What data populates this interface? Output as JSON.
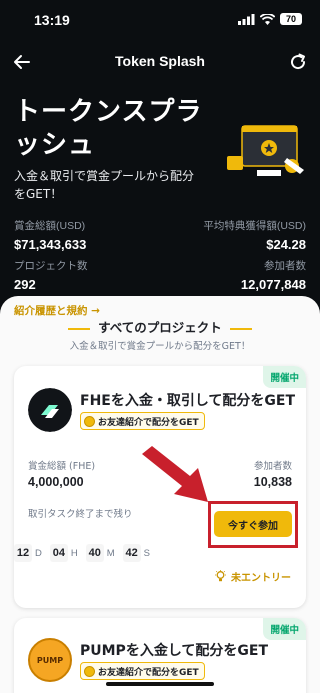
{
  "status_bar": {
    "time": "13:19",
    "battery": "70"
  },
  "nav": {
    "title": "Token Splash"
  },
  "hero": {
    "title": "トークンスプラッシュ",
    "subtitle": "入金＆取引で賞金プールから配分をGET！"
  },
  "stats": {
    "total_prize_label": "賞金総額(USD)",
    "total_prize_value": "$71,343,633",
    "avg_reward_label": "平均特典獲得額(USD)",
    "avg_reward_value": "$24.28",
    "project_count_label": "プロジェクト数",
    "project_count_value": "292",
    "participants_label": "参加者数",
    "participants_value": "12,077,848"
  },
  "history_link": "紹介履歴と規約 →",
  "section": {
    "title": "すべてのプロジェクト",
    "subtitle": "入金＆取引で賞金プールから配分をGET！"
  },
  "projects": [
    {
      "status": "開催中",
      "title": "FHEを入金・取引して配分をGET",
      "referral": "お友達紹介で配分をGET",
      "prize_label": "賞金総額 (FHE)",
      "prize_value": "4,000,000",
      "participants_label": "参加者数",
      "participants_value": "10,838",
      "countdown_label": "取引タスク終了まで残り",
      "countdown": {
        "days": "12",
        "d_unit": "D",
        "hours": "04",
        "h_unit": "H",
        "minutes": "40",
        "m_unit": "M",
        "seconds": "42",
        "s_unit": "S"
      },
      "join_button": "今すぐ参加",
      "entry_status": "未エントリー"
    },
    {
      "status": "開催中",
      "title": "PUMPを入金して配分をGET",
      "referral": "お友達紹介で配分をGET",
      "logo_text": "PUMP"
    }
  ],
  "colors": {
    "accent": "#f0b90b",
    "dark_bg": "#0b0e11",
    "open_green": "#03a66d",
    "annotation_red": "#c8202c"
  }
}
